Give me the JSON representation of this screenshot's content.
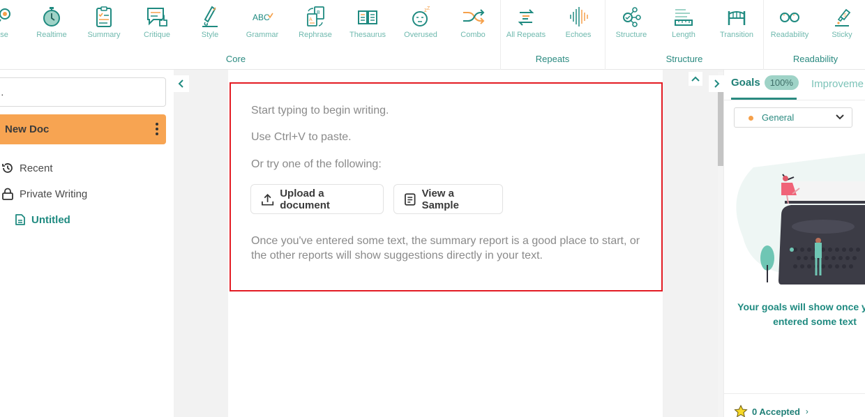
{
  "toolbar": {
    "tools": [
      {
        "id": "phrase",
        "label": "hase",
        "icon": "phrase-icon"
      },
      {
        "id": "realtime",
        "label": "Realtime",
        "icon": "stopwatch-icon"
      },
      {
        "id": "summary",
        "label": "Summary",
        "icon": "clipboard-checklist-icon"
      },
      {
        "id": "critique",
        "label": "Critique",
        "icon": "speech-thumbs-up-icon"
      },
      {
        "id": "style",
        "label": "Style",
        "icon": "pen-icon"
      },
      {
        "id": "grammar",
        "label": "Grammar",
        "icon": "abc-check-icon"
      },
      {
        "id": "rephrase",
        "label": "Rephrase",
        "icon": "rephrase-documents-icon"
      },
      {
        "id": "thesaurus",
        "label": "Thesaurus",
        "icon": "open-book-icon"
      },
      {
        "id": "overused",
        "label": "Overused",
        "icon": "sleepy-face-icon"
      },
      {
        "id": "combo",
        "label": "Combo",
        "icon": "shuffle-icon"
      },
      {
        "id": "all-repeats",
        "label": "All Repeats",
        "icon": "repeat-arrows-icon"
      },
      {
        "id": "echoes",
        "label": "Echoes",
        "icon": "sound-wave-icon"
      },
      {
        "id": "structure",
        "label": "Structure",
        "icon": "network-check-icon"
      },
      {
        "id": "length",
        "label": "Length",
        "icon": "ruler-lines-icon"
      },
      {
        "id": "transition",
        "label": "Transition",
        "icon": "bridge-icon"
      },
      {
        "id": "readability",
        "label": "Readability",
        "icon": "glasses-icon"
      },
      {
        "id": "sticky",
        "label": "Sticky",
        "icon": "glue-bottle-icon"
      }
    ],
    "groups": [
      {
        "label": "Core"
      },
      {
        "label": "Repeats"
      },
      {
        "label": "Structure"
      },
      {
        "label": "Readability"
      }
    ],
    "colors": {
      "teal": "#1f8a80",
      "orange": "#f5a04a",
      "label": "#6fb9ae"
    }
  },
  "sidebar": {
    "search_glyph": "․",
    "new_doc_label": "New Doc",
    "items": [
      {
        "label": "Recent",
        "icon": "history-icon"
      },
      {
        "label": "Private Writing",
        "icon": "lock-icon"
      },
      {
        "label": "Untitled",
        "icon": "document-icon",
        "active": true
      }
    ],
    "new_doc_color": "#f7a452"
  },
  "editor": {
    "hint_lines": [
      "Start typing to begin writing.",
      "Use Ctrl+V to paste.",
      "Or try one of the following:"
    ],
    "upload_button": "Upload a document",
    "sample_button": "View a Sample",
    "paragraph": "Once you've entered some text, the summary report is a good place to start, or the other reports will show suggestions directly in your text.",
    "highlight_color": "#e31b23"
  },
  "right_panel": {
    "tab_goals": "Goals",
    "goals_badge": "100%",
    "tab_improvements": "Improveme",
    "select_value": "General",
    "goals_message": "Your goals will show once you've entered some text",
    "accepted_label": "0 Accepted",
    "accepted_arrow": "›"
  }
}
